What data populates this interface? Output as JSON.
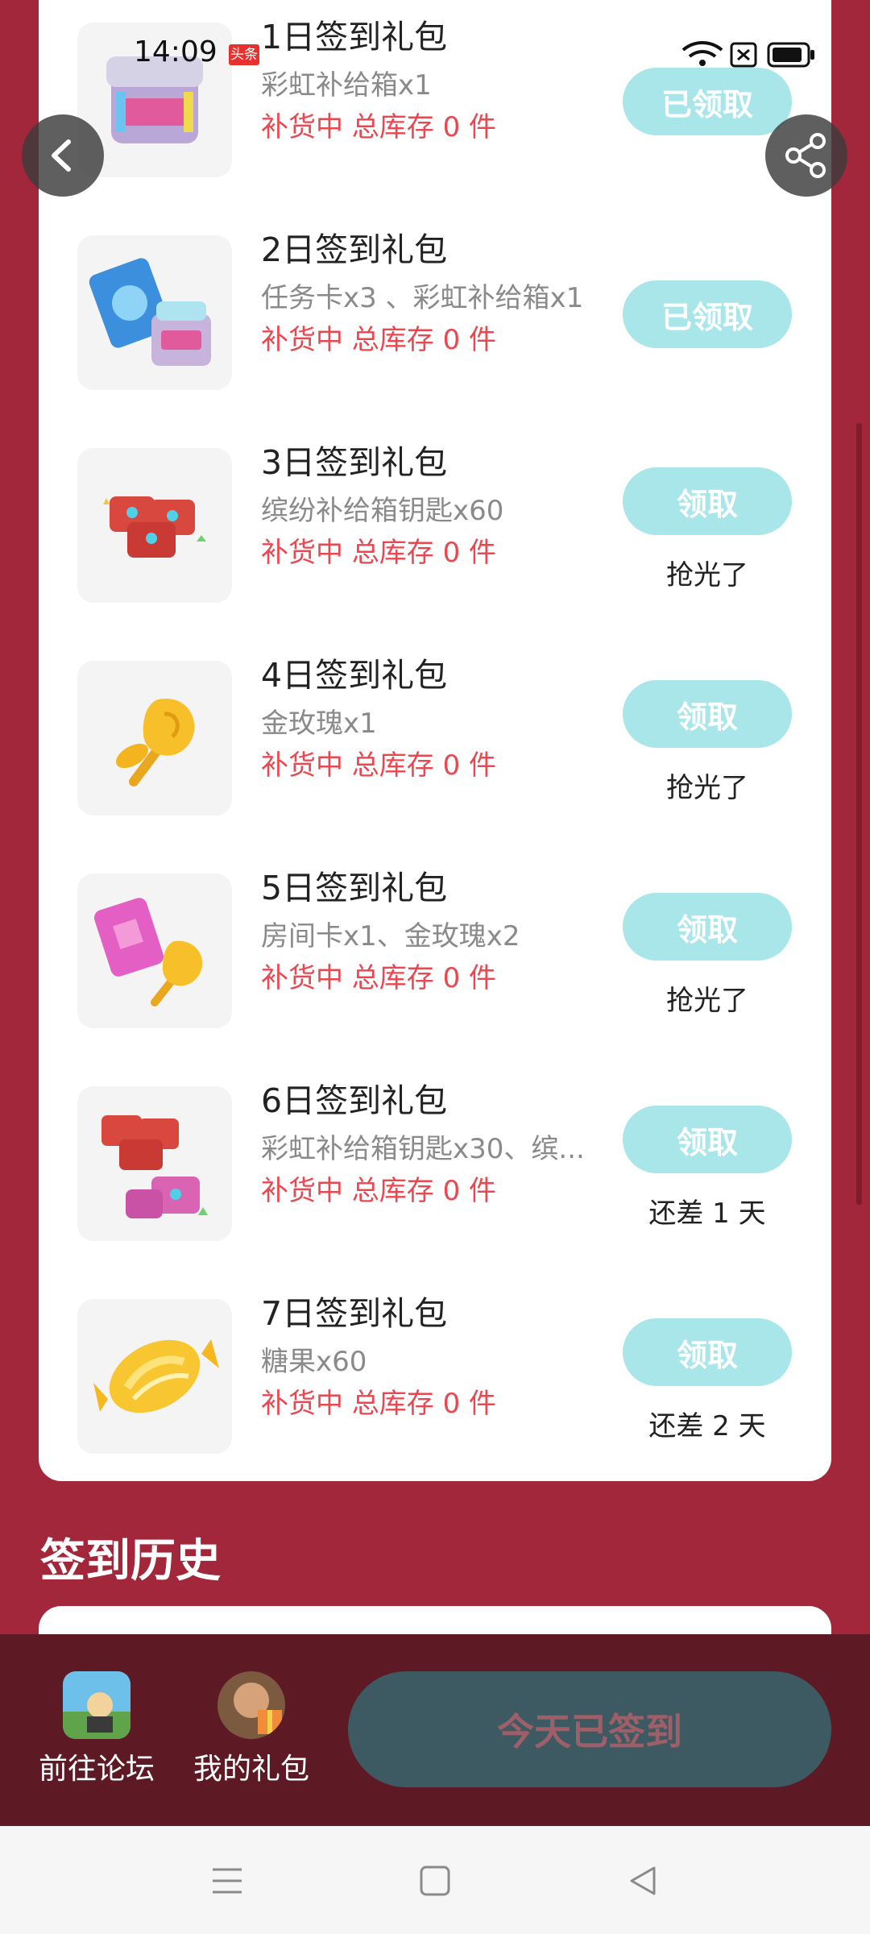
{
  "status_bar": {
    "time": "14:09",
    "app_badge": "头条"
  },
  "gifts": [
    {
      "title": "1日签到礼包",
      "items": "彩虹补给箱x1",
      "stock": "补货中 总库存 0 件",
      "button": "已领取",
      "note": "",
      "icon": "rainbow-supply-box"
    },
    {
      "title": "2日签到礼包",
      "items": "任务卡x3 、彩虹补给箱x1",
      "stock": "补货中 总库存 0 件",
      "button": "已领取",
      "note": "",
      "icon": "task-card-and-supply-box"
    },
    {
      "title": "3日签到礼包",
      "items": "缤纷补给箱钥匙x60",
      "stock": "补货中 总库存 0 件",
      "button": "领取",
      "note": "抢光了",
      "icon": "supply-box-keys"
    },
    {
      "title": "4日签到礼包",
      "items": "金玫瑰x1",
      "stock": "补货中 总库存 0 件",
      "button": "领取",
      "note": "抢光了",
      "icon": "golden-rose"
    },
    {
      "title": "5日签到礼包",
      "items": "房间卡x1、金玫瑰x2",
      "stock": "补货中 总库存 0 件",
      "button": "领取",
      "note": "抢光了",
      "icon": "room-card-and-rose"
    },
    {
      "title": "6日签到礼包",
      "items": "彩虹补给箱钥匙x30、缤...",
      "stock": "补货中 总库存 0 件",
      "button": "领取",
      "note": "还差 1 天",
      "icon": "keys-bundle"
    },
    {
      "title": "7日签到礼包",
      "items": "糖果x60",
      "stock": "补货中 总库存 0 件",
      "button": "领取",
      "note": "还差 2 天",
      "icon": "candy"
    }
  ],
  "history": {
    "title": "签到历史"
  },
  "bottom_bar": {
    "forum_label": "前往论坛",
    "gifts_label": "我的礼包",
    "signed_label": "今天已签到"
  },
  "colors": {
    "page_bg": "#a3273a",
    "button": "#a8e6ea",
    "stock_text": "#e94850",
    "bottom_bar": "#5e1a24"
  }
}
